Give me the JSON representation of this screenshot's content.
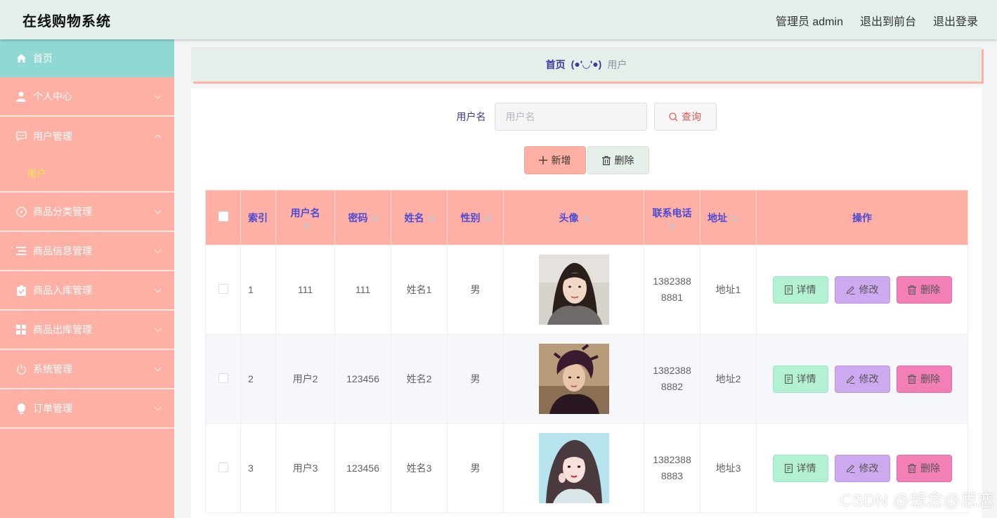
{
  "header": {
    "title": "在线购物系统",
    "admin_label": "管理员 admin",
    "front_link": "退出到前台",
    "logout": "退出登录"
  },
  "sidebar": {
    "home": "首页",
    "items": [
      {
        "label": "个人中心",
        "icon": "person-icon"
      },
      {
        "label": "用户管理",
        "icon": "chat-icon",
        "sub": [
          "用户"
        ]
      },
      {
        "label": "商品分类管理",
        "icon": "compass-icon"
      },
      {
        "label": "商品信息管理",
        "icon": "list-icon"
      },
      {
        "label": "商品入库管理",
        "icon": "clipboard-icon"
      },
      {
        "label": "商品出库管理",
        "icon": "grid-icon"
      },
      {
        "label": "系统管理",
        "icon": "power-icon"
      },
      {
        "label": "订单管理",
        "icon": "bulb-icon"
      }
    ]
  },
  "breadcrumb": {
    "home": "首页",
    "sep": "(●'◡'●)",
    "current": "用户"
  },
  "search": {
    "label": "用户名",
    "placeholder": "用户名",
    "button": "查询"
  },
  "actions": {
    "add": "新增",
    "delete": "删除"
  },
  "table": {
    "headers": [
      "索引",
      "用户名",
      "密码",
      "姓名",
      "性别",
      "头像",
      "联系电话",
      "地址",
      "操作"
    ],
    "rows": [
      {
        "index": "1",
        "username": "111",
        "password": "111",
        "name": "姓名1",
        "gender": "男",
        "phone1": "1382388",
        "phone2": "8881",
        "address": "地址1"
      },
      {
        "index": "2",
        "username": "用户2",
        "password": "123456",
        "name": "姓名2",
        "gender": "男",
        "phone1": "1382388",
        "phone2": "8882",
        "address": "地址2"
      },
      {
        "index": "3",
        "username": "用户3",
        "password": "123456",
        "name": "姓名3",
        "gender": "男",
        "phone1": "1382388",
        "phone2": "8883",
        "address": "地址3"
      }
    ],
    "ops": {
      "detail": "详情",
      "edit": "修改",
      "remove": "删除"
    }
  },
  "colors": {
    "header_bg": "#e3efe8",
    "sidebar_bg": "#fdb0a3",
    "home_bg": "#8fd9d2",
    "table_header_bg": "#fdb0a3",
    "detail_btn": "#b3f1d3",
    "edit_btn": "#cda9ef",
    "remove_btn": "#f27fb6"
  },
  "watermark": "CSDN @想念@思恋"
}
